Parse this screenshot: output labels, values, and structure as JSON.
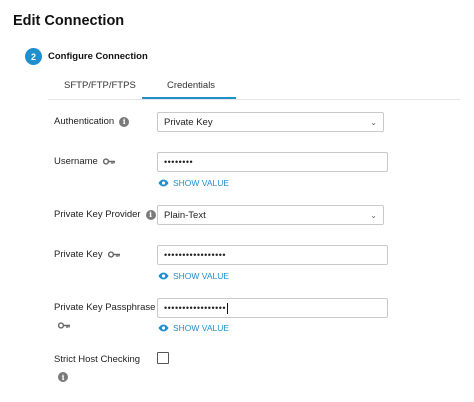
{
  "page": {
    "title": "Edit Connection"
  },
  "step": {
    "number": "2",
    "title": "Configure Connection"
  },
  "tabs": [
    {
      "label": "SFTP/FTP/FTPS",
      "active": false
    },
    {
      "label": "Credentials",
      "active": true
    }
  ],
  "fields": {
    "authentication": {
      "label": "Authentication",
      "value": "Private Key"
    },
    "username": {
      "label": "Username",
      "value": "••••••••"
    },
    "private_key_provider": {
      "label": "Private Key Provider",
      "value": "Plain-Text"
    },
    "private_key": {
      "label": "Private Key",
      "value": "•••••••••••••••••"
    },
    "private_key_passphrase": {
      "label": "Private Key Passphrase",
      "value": "•••••••••••••••••"
    },
    "strict_host_checking": {
      "label": "Strict Host Checking",
      "checked": false
    }
  },
  "show_value_label": "SHOW VALUE",
  "colors": {
    "accent": "#1f8fce"
  },
  "icons": {
    "info": "info-icon",
    "key": "key-icon",
    "eye": "eye-icon",
    "chevron": "chevron-down-icon"
  }
}
